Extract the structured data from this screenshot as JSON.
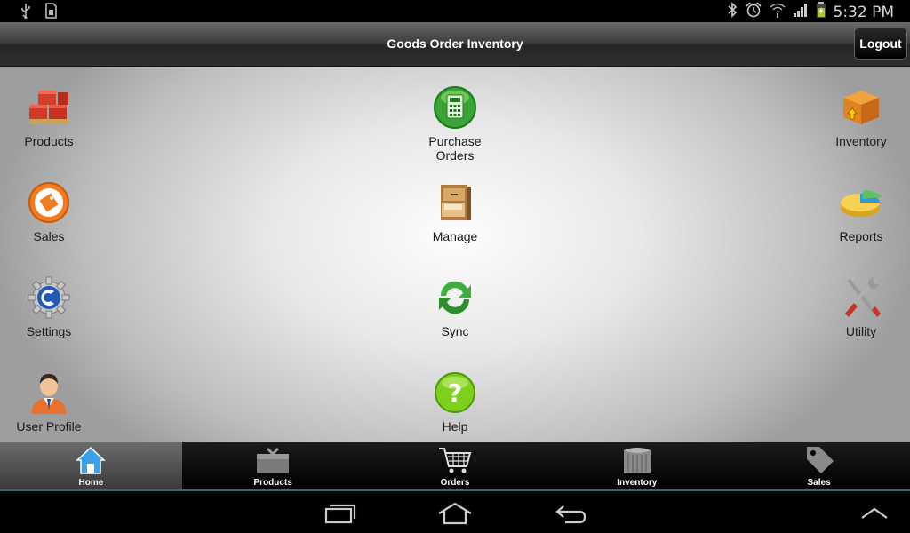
{
  "status": {
    "time": "5:32 PM"
  },
  "header": {
    "title": "Goods Order Inventory",
    "logout_label": "Logout"
  },
  "grid": {
    "products": "Products",
    "purchase_orders_line1": "Purchase",
    "purchase_orders_line2": "Orders",
    "inventory": "Inventory",
    "sales": "Sales",
    "manage": "Manage",
    "reports": "Reports",
    "settings": "Settings",
    "sync": "Sync",
    "utility": "Utility",
    "user_profile": "User Profile",
    "help": "Help"
  },
  "tabs": {
    "home": "Home",
    "products": "Products",
    "orders": "Orders",
    "inventory": "Inventory",
    "sales": "Sales"
  },
  "colors": {
    "accent": "#2c6a80",
    "header_dark": "#262626"
  }
}
